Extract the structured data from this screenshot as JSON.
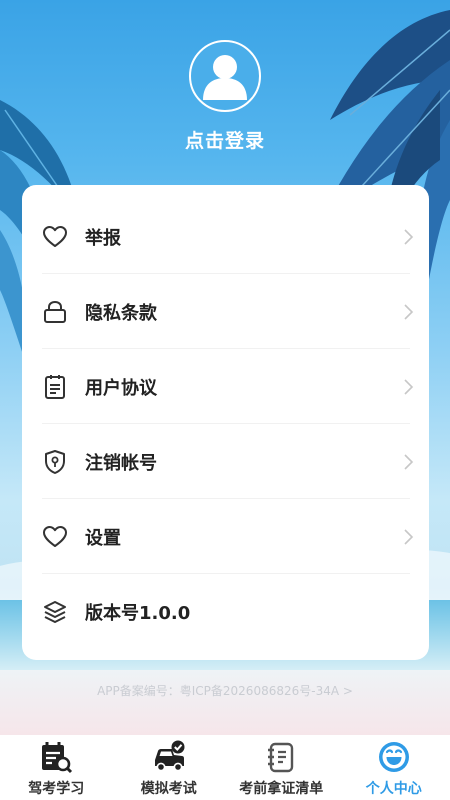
{
  "profile": {
    "login_label": "点击登录"
  },
  "menu": {
    "items": [
      {
        "label": "举报",
        "icon": "heart-icon"
      },
      {
        "label": "隐私条款",
        "icon": "lock-icon"
      },
      {
        "label": "用户协议",
        "icon": "document-icon"
      },
      {
        "label": "注销帐号",
        "icon": "shield-icon"
      },
      {
        "label": "设置",
        "icon": "heart-icon"
      },
      {
        "label": "版本号1.0.0",
        "icon": "layers-icon"
      }
    ]
  },
  "footer": {
    "icp_text": "APP备案编号：粤ICP备2026086826号-34A >"
  },
  "tabbar": {
    "tabs": [
      {
        "label": "驾考学习",
        "icon": "calendar-search-icon",
        "active": false
      },
      {
        "label": "模拟考试",
        "icon": "car-check-icon",
        "active": false
      },
      {
        "label": "考前拿证清单",
        "icon": "notebook-icon",
        "active": false
      },
      {
        "label": "个人中心",
        "icon": "smile-icon",
        "active": true
      }
    ]
  },
  "colors": {
    "accent": "#2f9be6",
    "text": "#222222",
    "sky": "#3aa3e6"
  }
}
